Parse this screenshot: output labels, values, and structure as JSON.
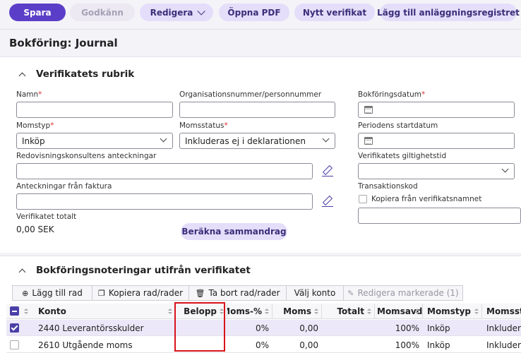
{
  "toolbar": {
    "save": "Spara",
    "approve": "Godkänn",
    "edit": "Redigera",
    "open_pdf": "Öppna PDF",
    "new_voucher": "Nytt verifikat",
    "add_asset": "Lägg till anläggningsregistret"
  },
  "page_title": "Bokföring: Journal",
  "header_section": {
    "title": "Verifikatets rubrik",
    "name_label": "Namn",
    "name_value": "",
    "org_label": "Organisationsnummer/personnummer",
    "org_value": "",
    "booking_date_label": "Bokföringsdatum",
    "vat_type_label": "Momstyp",
    "vat_type_value": "Inköp",
    "vat_status_label": "Momsstatus",
    "vat_status_value": "Inkluderas ej i deklarationen",
    "period_start_label": "Periodens startdatum",
    "consultant_notes_label": "Redovisningskonsultens anteckningar",
    "validity_label": "Verifikatets giltighetstid",
    "invoice_notes_label": "Anteckningar från faktura",
    "transaction_code_label": "Transaktionskod",
    "copy_from_name_label": "Kopiera från verifikatsnamnet",
    "total_label": "Verifikatet totalt",
    "total_value": "0,00 SEK",
    "calc_summary": "Beräkna sammandrag",
    "required_mark": "*"
  },
  "lines_section": {
    "title": "Bokföringsnoteringar utifrån verifikatet",
    "add_row": "Lägg till rad",
    "copy_rows": "Kopiera rad/rader",
    "delete_rows": "Ta bort rad/rader",
    "choose_account": "Välj konto",
    "edit_selected": "Redigera markerade (1)",
    "columns": [
      "Konto",
      "Belopp",
      "Moms-%",
      "Moms",
      "Totalt",
      "Momsavdrag",
      "Momstyp",
      "Momsstatus"
    ],
    "rows": [
      {
        "konto": "2440 Leverantörsskulder",
        "belopp": "",
        "moms_pct": "0%",
        "moms": "0,00",
        "totalt": "",
        "momsavdrag": "100%",
        "momstyp": "Inköp",
        "momsstatus": "Inkluderas",
        "selected": true
      },
      {
        "konto": "2610 Utgående moms",
        "belopp": "",
        "moms_pct": "0%",
        "moms": "0,00",
        "totalt": "",
        "momsavdrag": "100%",
        "momstyp": "Inköp",
        "momsstatus": "Inkluderas",
        "selected": false
      }
    ]
  },
  "colors": {
    "primary": "#5b3ec8",
    "secondary": "#e4defa",
    "highlight_box": "#d8121b",
    "selected_row": "#ece8f9"
  }
}
